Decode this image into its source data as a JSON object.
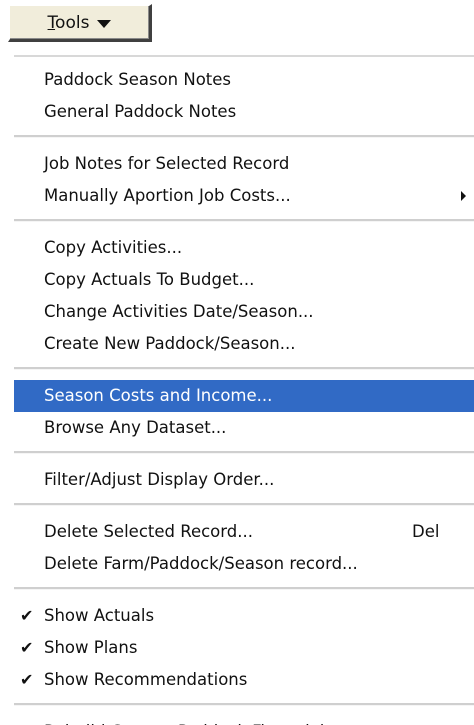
{
  "tools_button": {
    "label_underlined": "T",
    "label_rest": "ools",
    "icon": "chevron-down-icon"
  },
  "menu": {
    "groups": [
      {
        "items": [
          {
            "label": "Paddock Season Notes"
          },
          {
            "label": "General Paddock Notes"
          }
        ]
      },
      {
        "items": [
          {
            "label": "Job Notes for Selected Record"
          },
          {
            "label": "Manually Aportion Job Costs...",
            "submenu": true
          }
        ]
      },
      {
        "items": [
          {
            "label": "Copy Activities..."
          },
          {
            "label": "Copy Actuals To Budget..."
          },
          {
            "label": "Change Activities Date/Season..."
          },
          {
            "label": "Create New Paddock/Season..."
          }
        ]
      },
      {
        "items": [
          {
            "label": "Season Costs and Income...",
            "highlighted": true
          },
          {
            "label": "Browse Any Dataset..."
          }
        ]
      },
      {
        "items": [
          {
            "label": "Filter/Adjust Display Order..."
          }
        ]
      },
      {
        "items": [
          {
            "label": "Delete Selected Record...",
            "shortcut": "Del"
          },
          {
            "label": "Delete Farm/Paddock/Season record..."
          }
        ]
      },
      {
        "items": [
          {
            "label": "Show Actuals",
            "checked": true
          },
          {
            "label": "Show Plans",
            "checked": true
          },
          {
            "label": "Show Recommendations",
            "checked": true
          }
        ]
      },
      {
        "items": [
          {
            "label": "Rebuild  Current Paddock Financials"
          }
        ]
      }
    ],
    "check_glyph": "✔",
    "colors": {
      "highlight": "#316ac5",
      "highlight_text": "#ffffff",
      "button_face": "#f1eddb"
    }
  }
}
